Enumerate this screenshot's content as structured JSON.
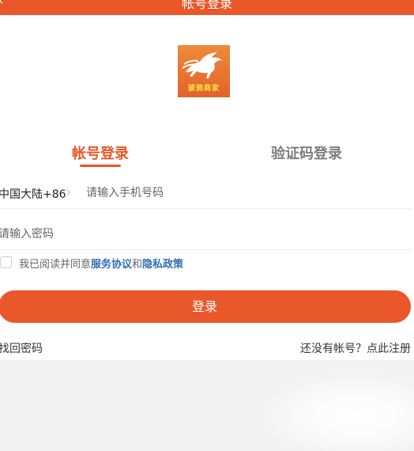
{
  "header": {
    "back_icon": "chevron-left-icon",
    "title": "帐号登录"
  },
  "logo": {
    "brand_text": "骏驰商家",
    "icon": "horse-logo-icon"
  },
  "tabs": [
    {
      "label": "帐号登录",
      "active": true
    },
    {
      "label": "验证码登录",
      "active": false
    }
  ],
  "phone": {
    "region": "中国大陆+86",
    "placeholder": "请输入手机号码",
    "value": ""
  },
  "password": {
    "placeholder": "请输入密码",
    "value": ""
  },
  "agreement": {
    "prefix": "我已阅读并同意",
    "service_link": "服务协议",
    "and": "和",
    "privacy_link": "隐私政策",
    "checked": false
  },
  "login_button": "登录",
  "forgot_password": "找回密码",
  "register": "还没有帐号？点此注册",
  "colors": {
    "accent": "#e9572a",
    "link": "#2f6fb7"
  }
}
